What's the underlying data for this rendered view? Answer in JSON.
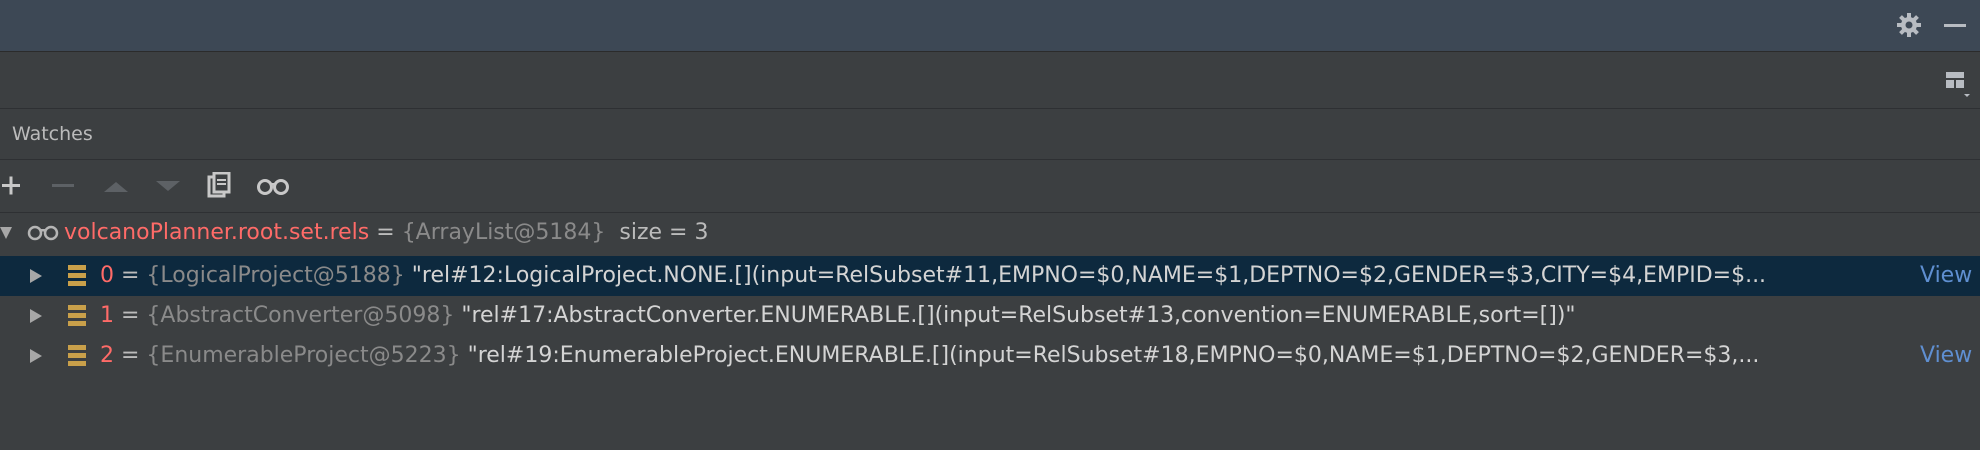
{
  "icons": {
    "top_right": [
      "gear-icon",
      "minimize-icon"
    ],
    "toolbar": [
      "plus-icon",
      "minus-icon",
      "move-up-icon",
      "move-down-icon",
      "copy-icon",
      "glasses-icon"
    ],
    "layout": "layout-icon"
  },
  "colors": {
    "background": "#3c3f41",
    "topbar": "#3d4855",
    "selected_row": "#0d293e",
    "variable_name": "#ff6b68",
    "type_text": "#8a8a8a",
    "link": "#5f8fd1"
  },
  "watches": {
    "title": "Watches",
    "root": {
      "name": "volcanoPlanner.root.set.rels",
      "eq": " = ",
      "type": "{ArrayList@5184}",
      "size": "size = 3"
    },
    "items": [
      {
        "index": "0",
        "eq": " = ",
        "type": "{LogicalProject@5188}",
        "value": "\"rel#12:LogicalProject.NONE.[](input=RelSubset#11,EMPNO=$0,NAME=$1,DEPTNO=$2,GENDER=$3,CITY=$4,EMPID=$...",
        "link": "View"
      },
      {
        "index": "1",
        "eq": " = ",
        "type": "{AbstractConverter@5098}",
        "value": "\"rel#17:AbstractConverter.ENUMERABLE.[](input=RelSubset#13,convention=ENUMERABLE,sort=[])\"",
        "link": ""
      },
      {
        "index": "2",
        "eq": " = ",
        "type": "{EnumerableProject@5223}",
        "value": "\"rel#19:EnumerableProject.ENUMERABLE.[](input=RelSubset#18,EMPNO=$0,NAME=$1,DEPTNO=$2,GENDER=$3,...",
        "link": "View"
      }
    ]
  }
}
